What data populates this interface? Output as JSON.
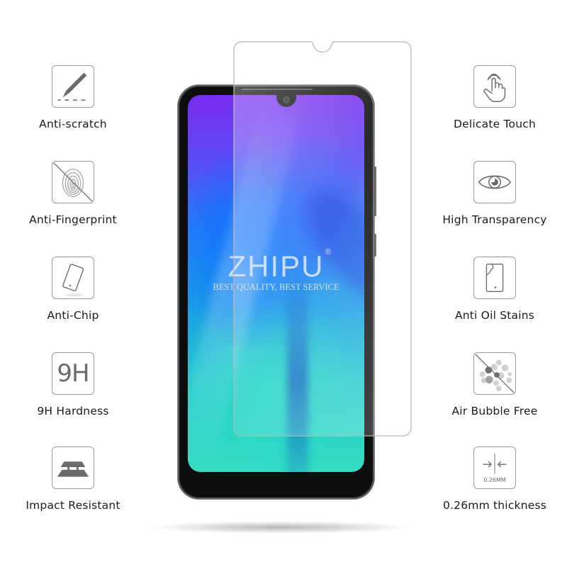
{
  "product": {
    "brand": "ZHIPU",
    "trademark": "®",
    "tagline": "BEST QUALITY, BEST SERVICE"
  },
  "features_left": [
    {
      "icon": "scalpel-scratch-icon",
      "label": "Anti-scratch"
    },
    {
      "icon": "crossed-fingerprint-icon",
      "label": "Anti-Fingerprint"
    },
    {
      "icon": "tilted-phone-icon",
      "label": "Anti-Chip"
    },
    {
      "icon": "9h-icon",
      "label": "9H Hardness",
      "icon_text": "9H"
    },
    {
      "icon": "layered-plates-icon",
      "label": "Impact Resistant"
    }
  ],
  "features_right": [
    {
      "icon": "touch-hand-icon",
      "label": "Delicate Touch"
    },
    {
      "icon": "eye-icon",
      "label": "High Transparency"
    },
    {
      "icon": "cracked-phone-icon",
      "label": "Anti Oil Stains"
    },
    {
      "icon": "crossed-bubbles-icon",
      "label": "Air Bubble Free"
    },
    {
      "icon": "thickness-arrows-icon",
      "label": "0.26mm thickness",
      "icon_text": "0.26MM"
    }
  ],
  "colors": {
    "icon_border": "#9a9a9a",
    "icon_fill": "#6b6b6b",
    "text": "#1a1a1a"
  }
}
